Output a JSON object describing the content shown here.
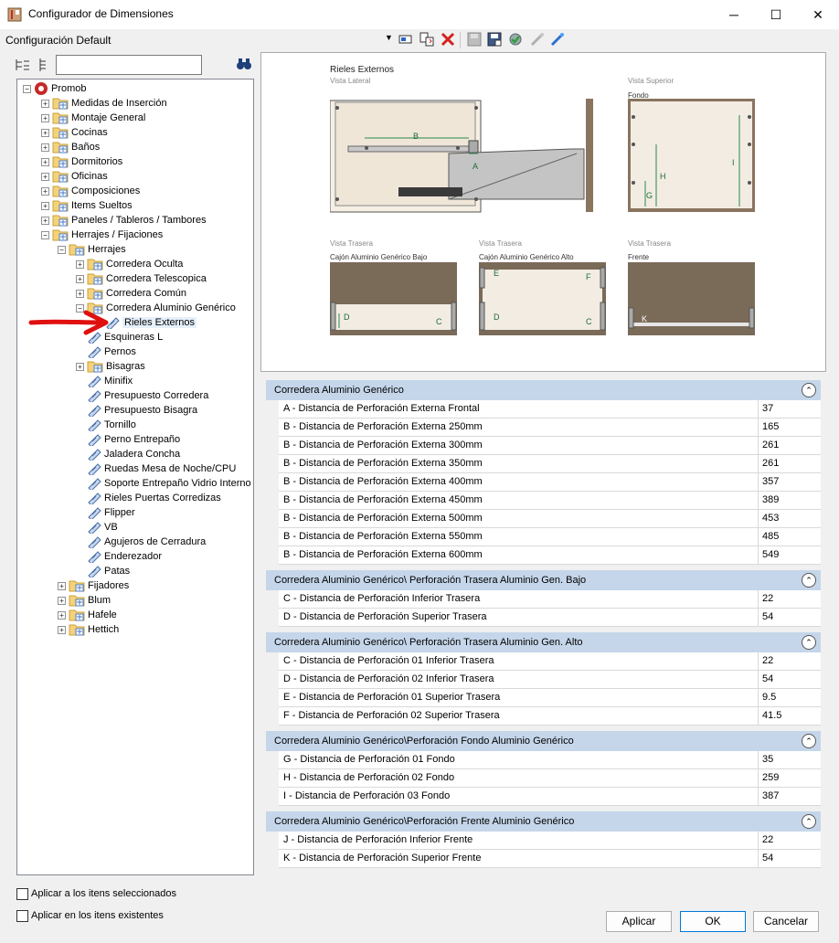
{
  "window": {
    "title": "Configurador de Dimensiones",
    "min": "─",
    "max": "☐",
    "close": "✕"
  },
  "toolbar": {
    "config_label": "Configuración Default",
    "arrow": "▼"
  },
  "search": {
    "value": ""
  },
  "tree": [
    {
      "label": "Promob",
      "level": 0,
      "exp": "−",
      "icon": "root"
    },
    {
      "label": "Medidas de Inserción",
      "level": 1,
      "exp": "+",
      "icon": "folder"
    },
    {
      "label": "Montaje General",
      "level": 1,
      "exp": "+",
      "icon": "folder"
    },
    {
      "label": "Cocinas",
      "level": 1,
      "exp": "+",
      "icon": "folder"
    },
    {
      "label": "Baños",
      "level": 1,
      "exp": "+",
      "icon": "folder"
    },
    {
      "label": "Dormitorios",
      "level": 1,
      "exp": "+",
      "icon": "folder"
    },
    {
      "label": "Oficinas",
      "level": 1,
      "exp": "+",
      "icon": "folder"
    },
    {
      "label": "Composiciones",
      "level": 1,
      "exp": "+",
      "icon": "folder"
    },
    {
      "label": "Items Sueltos",
      "level": 1,
      "exp": "+",
      "icon": "folder"
    },
    {
      "label": "Paneles / Tableros / Tambores",
      "level": 1,
      "exp": "+",
      "icon": "folder"
    },
    {
      "label": "Herrajes / Fijaciones",
      "level": 1,
      "exp": "−",
      "icon": "folder"
    },
    {
      "label": "Herrajes",
      "level": 2,
      "exp": "−",
      "icon": "folder"
    },
    {
      "label": "Corredera Oculta",
      "level": 3,
      "exp": "+",
      "icon": "folder"
    },
    {
      "label": "Corredera Telescopica",
      "level": 3,
      "exp": "+",
      "icon": "folder"
    },
    {
      "label": "Corredera Común",
      "level": 3,
      "exp": "+",
      "icon": "folder"
    },
    {
      "label": "Corredera Aluminio Genérico",
      "level": 3,
      "exp": "−",
      "icon": "folder"
    },
    {
      "label": "Rieles Externos",
      "level": 4,
      "exp": "",
      "icon": "leaf",
      "selected": true
    },
    {
      "label": "Esquineras L",
      "level": 3,
      "exp": "",
      "icon": "leaf"
    },
    {
      "label": "Pernos",
      "level": 3,
      "exp": "",
      "icon": "leaf"
    },
    {
      "label": "Bisagras",
      "level": 3,
      "exp": "+",
      "icon": "folder"
    },
    {
      "label": "Minifix",
      "level": 3,
      "exp": "",
      "icon": "leaf"
    },
    {
      "label": "Presupuesto Corredera",
      "level": 3,
      "exp": "",
      "icon": "leaf"
    },
    {
      "label": "Presupuesto Bisagra",
      "level": 3,
      "exp": "",
      "icon": "leaf"
    },
    {
      "label": "Tornillo",
      "level": 3,
      "exp": "",
      "icon": "leaf"
    },
    {
      "label": "Perno Entrepaño",
      "level": 3,
      "exp": "",
      "icon": "leaf"
    },
    {
      "label": "Jaladera Concha",
      "level": 3,
      "exp": "",
      "icon": "leaf"
    },
    {
      "label": "Ruedas Mesa de Noche/CPU",
      "level": 3,
      "exp": "",
      "icon": "leaf"
    },
    {
      "label": "Soporte Entrepaño Vidrio Interno",
      "level": 3,
      "exp": "",
      "icon": "leaf"
    },
    {
      "label": "Rieles Puertas Corredizas",
      "level": 3,
      "exp": "",
      "icon": "leaf"
    },
    {
      "label": "Flipper",
      "level": 3,
      "exp": "",
      "icon": "leaf"
    },
    {
      "label": "VB",
      "level": 3,
      "exp": "",
      "icon": "leaf"
    },
    {
      "label": "Agujeros de Cerradura",
      "level": 3,
      "exp": "",
      "icon": "leaf"
    },
    {
      "label": "Enderezador",
      "level": 3,
      "exp": "",
      "icon": "leaf"
    },
    {
      "label": "Patas",
      "level": 3,
      "exp": "",
      "icon": "leaf"
    },
    {
      "label": "Fijadores",
      "level": 2,
      "exp": "+",
      "icon": "folder"
    },
    {
      "label": "Blum",
      "level": 2,
      "exp": "+",
      "icon": "folder"
    },
    {
      "label": "Hafele",
      "level": 2,
      "exp": "+",
      "icon": "folder"
    },
    {
      "label": "Hettich",
      "level": 2,
      "exp": "+",
      "icon": "folder"
    }
  ],
  "preview": {
    "title": "Rieles Externos",
    "vista_lateral": "Vista Lateral",
    "vista_superior": "Vista Superior",
    "fondo": "Fondo",
    "vista_trasera": "Vista Trasera",
    "bajo": "Cajón Aluminio Genérico Bajo",
    "alto": "Cajón Aluminio Genérico Alto",
    "frente": "Frente",
    "labels": {
      "A": "A",
      "B": "B",
      "C": "C",
      "D": "D",
      "E": "E",
      "F": "F",
      "G": "G",
      "H": "H",
      "I": "I",
      "K": "K"
    }
  },
  "sections": [
    {
      "title": "Corredera Aluminio Genérico",
      "rows": [
        {
          "name": "A - Distancia de Perforación Externa Frontal",
          "value": "37"
        },
        {
          "name": "B - Distancia de Perforación Externa 250mm",
          "value": "165"
        },
        {
          "name": "B - Distancia de Perforación Externa 300mm",
          "value": "261"
        },
        {
          "name": "B - Distancia de Perforación Externa 350mm",
          "value": "261"
        },
        {
          "name": "B - Distancia de Perforación Externa 400mm",
          "value": "357"
        },
        {
          "name": "B - Distancia de Perforación Externa 450mm",
          "value": "389"
        },
        {
          "name": "B - Distancia de Perforación Externa 500mm",
          "value": "453"
        },
        {
          "name": "B - Distancia de Perforación Externa 550mm",
          "value": "485"
        },
        {
          "name": "B - Distancia de Perforación Externa 600mm",
          "value": "549"
        }
      ]
    },
    {
      "title": "Corredera Aluminio Genérico\\  Perforación Trasera Aluminio Gen. Bajo",
      "rows": [
        {
          "name": "C - Distancia de Perforación Inferior Trasera",
          "value": "22"
        },
        {
          "name": "D - Distancia de Perforación Superior Trasera",
          "value": "54"
        }
      ]
    },
    {
      "title": "Corredera Aluminio Genérico\\ Perforación Trasera Aluminio Gen. Alto",
      "rows": [
        {
          "name": "C - Distancia de Perforación 01 Inferior Trasera",
          "value": "22"
        },
        {
          "name": "D - Distancia de Perforación 02 Inferior Trasera",
          "value": "54"
        },
        {
          "name": "E - Distancia de Perforación 01 Superior Trasera",
          "value": "9.5"
        },
        {
          "name": "F - Distancia de Perforación 02 Superior Trasera",
          "value": "41.5"
        }
      ]
    },
    {
      "title": "Corredera Aluminio Genérico\\Perforación Fondo Aluminio Genérico",
      "rows": [
        {
          "name": "G - Distancia de Perforación 01 Fondo",
          "value": "35"
        },
        {
          "name": "H - Distancia de Perforación 02 Fondo",
          "value": "259"
        },
        {
          "name": "I - Distancia de Perforación 03 Fondo",
          "value": "387"
        }
      ]
    },
    {
      "title": "Corredera Aluminio Genérico\\Perforación Frente Aluminio Genérico",
      "rows": [
        {
          "name": "J - Distancia de Perforación Inferior Frente",
          "value": "22"
        },
        {
          "name": "K - Distancia de Perforación Superior Frente",
          "value": "54"
        }
      ]
    }
  ],
  "options": {
    "apply_selected": "Aplicar a los itens seleccionados",
    "apply_existing": "Aplicar en los itens existentes"
  },
  "buttons": {
    "apply": "Aplicar",
    "ok": "OK",
    "cancel": "Cancelar"
  },
  "colors": {
    "section_header": "#c5d6ea",
    "wood": "#7a6a58",
    "arrow": "#e01010"
  }
}
